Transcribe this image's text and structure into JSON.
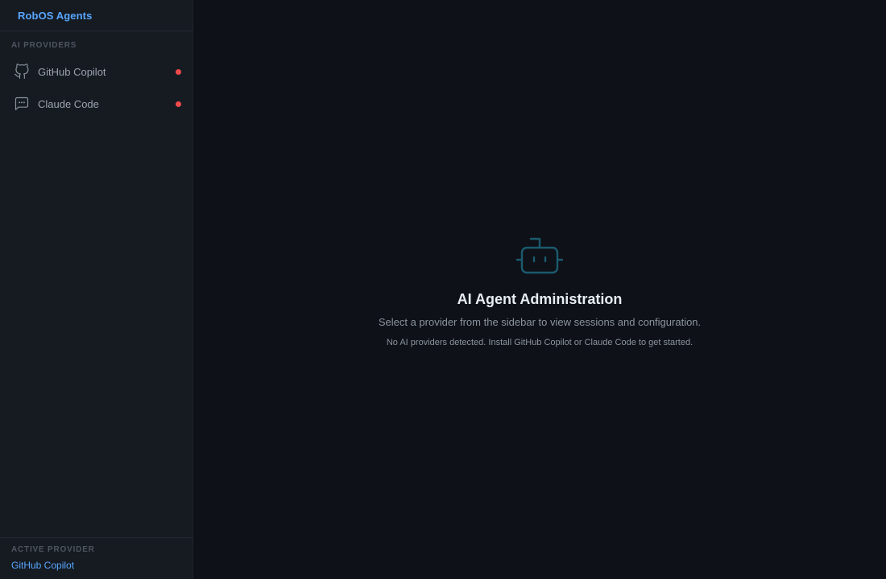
{
  "app": {
    "title": "RobOS Agents"
  },
  "sidebar": {
    "section_label": "AI PROVIDERS",
    "items": [
      {
        "label": "GitHub Copilot",
        "icon": "github-icon",
        "status": "unavailable",
        "status_color": "#f04b4b"
      },
      {
        "label": "Claude Code",
        "icon": "chat-icon",
        "status": "unavailable",
        "status_color": "#f04b4b"
      }
    ],
    "footer": {
      "label": "ACTIVE PROVIDER",
      "value": "GitHub Copilot"
    }
  },
  "main": {
    "icon": "robot-icon",
    "title": "AI Agent Administration",
    "subtitle": "Select a provider from the sidebar to view sessions and configuration.",
    "note": "No AI providers detected. Install GitHub Copilot or Claude Code to get started."
  },
  "colors": {
    "accent": "#58a6ff",
    "icon_teal": "#1b5a6e",
    "status_red": "#f04b4b"
  }
}
